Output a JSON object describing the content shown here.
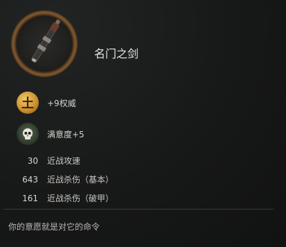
{
  "item": {
    "name": "名门之剑",
    "icon": "sword-icon"
  },
  "effects": [
    {
      "icon": "gold-earth-token-icon",
      "glyph": "土",
      "text": "+9权威"
    },
    {
      "icon": "skull-satisfaction-icon",
      "text": "满意度+5"
    }
  ],
  "stats": [
    {
      "value": "30",
      "label": "近战攻速"
    },
    {
      "value": "643",
      "label": "近战杀伤（基本）"
    },
    {
      "value": "161",
      "label": "近战杀伤（破甲）"
    }
  ],
  "flavor_text": "你的意愿就是对它的命令",
  "colors": {
    "ring": "#a7743d",
    "gold_badge": "#c78c2a",
    "skull_badge": "#2b3627"
  }
}
